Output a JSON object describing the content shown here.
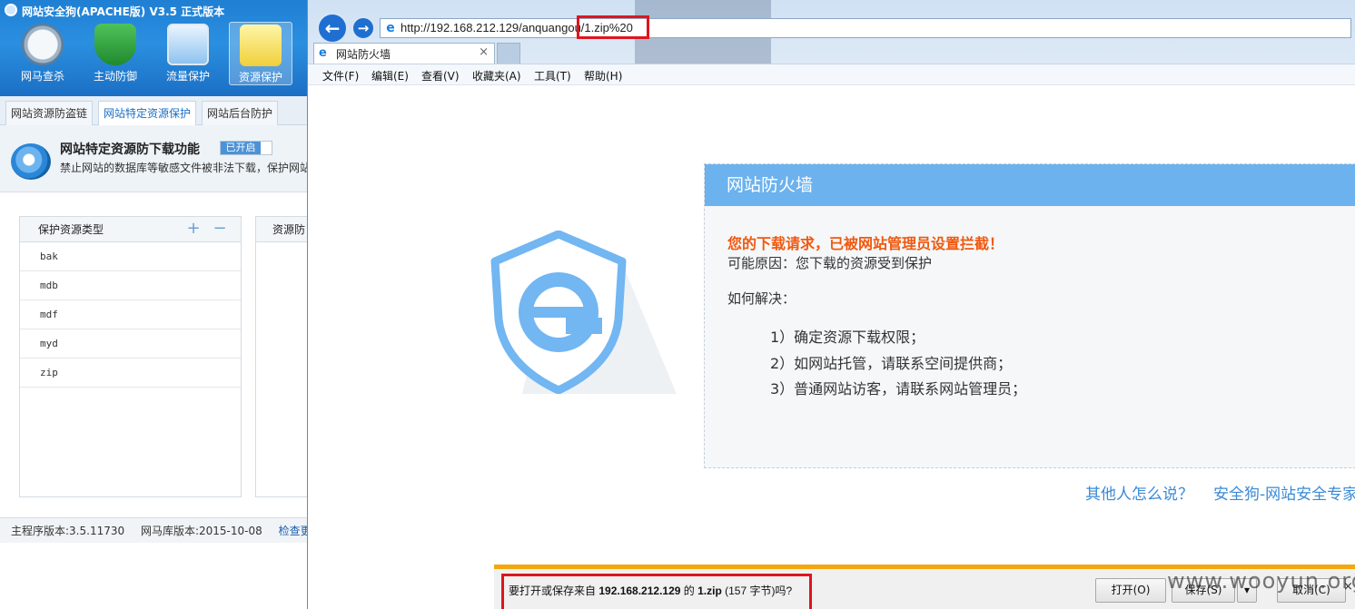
{
  "app": {
    "title": "网站安全狗(APACHE版) V3.5 正式版本",
    "nav": [
      {
        "label": "网马查杀",
        "icon": "scan-gauge-icon"
      },
      {
        "label": "主动防御",
        "icon": "shield-icon"
      },
      {
        "label": "流量保护",
        "icon": "traffic-chart-icon"
      },
      {
        "label": "资源保护",
        "icon": "folder-icon",
        "active": true
      }
    ],
    "tabs": [
      {
        "label": "网站资源防盗链"
      },
      {
        "label": "网站特定资源保护",
        "active": true
      },
      {
        "label": "网站后台防护"
      }
    ],
    "feature": {
      "title": "网站特定资源防下载功能",
      "badge": "已开启",
      "desc": "禁止网站的数据库等敏感文件被非法下载，保护网站"
    },
    "resource_list": {
      "header": "保护资源类型",
      "plus": "+",
      "minus": "−",
      "items": [
        "bak",
        "mdb",
        "mdf",
        "myd",
        "zip"
      ]
    },
    "right_panel_header": "资源防",
    "status": {
      "version": "主程序版本:3.5.11730",
      "db_version": "网马库版本:2015-10-08",
      "update": "检查更新"
    }
  },
  "browser": {
    "url": "http://192.168.212.129/anquangou/1.zip%20",
    "tab_title": "网站防火墙",
    "tab_close": "×",
    "menu": [
      "文件(F)",
      "编辑(E)",
      "查看(V)",
      "收藏夹(A)",
      "工具(T)",
      "帮助(H)"
    ],
    "back_glyph": "←",
    "forward_glyph": "→",
    "ie_glyph": "e"
  },
  "page": {
    "card_title": "网站防火墙",
    "alert": "您的下载请求，已被网站管理员设置拦截！",
    "reason": "可能原因：您下载的资源受到保护",
    "how": "如何解决：",
    "steps": [
      "1）确定资源下载权限；",
      "2）如网站托管，请联系空间提供商；",
      "3）普通网站访客，请联系网站管理员；"
    ],
    "link_others": "其他人怎么说？",
    "link_brand": "安全狗-网站安全专家",
    "colors": {
      "card_header": "#6cb2ee",
      "alert": "#f0580e",
      "link": "#3a8ad6"
    }
  },
  "download_bar": {
    "prefix": "要打开或保存来自 ",
    "host": "192.168.212.129",
    "mid": " 的 ",
    "file": "1.zip",
    "suffix": " (157 字节)吗?",
    "open": "打开(O)",
    "save": "保存(S)",
    "save_arrow": "▾",
    "cancel": "取消(C)",
    "close": "×",
    "watermark": "www.wooyun.org"
  }
}
